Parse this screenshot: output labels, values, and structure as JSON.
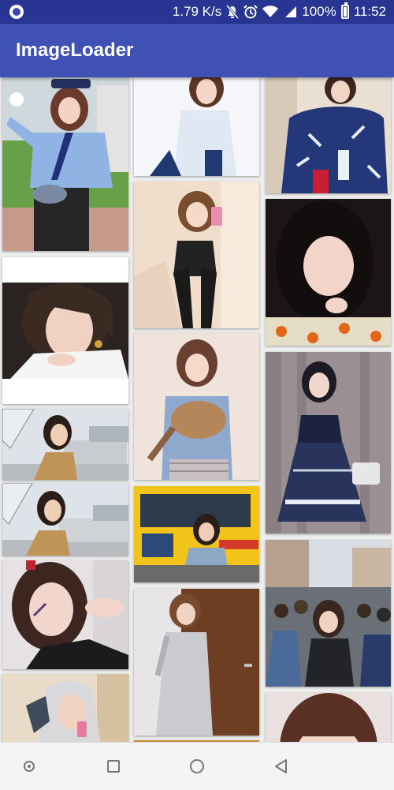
{
  "status_bar": {
    "speed": "1.79 K/s",
    "battery_percent": "100%",
    "time": "11:52",
    "icons": [
      "notification-app-icon",
      "mute-icon",
      "alarm-icon",
      "wifi-icon",
      "signal-icon",
      "battery-charging-icon"
    ]
  },
  "app_bar": {
    "title": "ImageLoader"
  },
  "colors": {
    "status_bar": "#283593",
    "app_bar": "#3f51b5",
    "background": "#eeeeee"
  },
  "grid": {
    "columns": 3,
    "photos": [
      {
        "name": "photo-police-cosplay",
        "column": 1
      },
      {
        "name": "photo-white-shirt",
        "column": 2
      },
      {
        "name": "photo-blue-kimono",
        "column": 3
      },
      {
        "name": "photo-mirror-selfie",
        "column": 2
      },
      {
        "name": "photo-halloween-selfie",
        "column": 3
      },
      {
        "name": "photo-gold-earring",
        "column": 1
      },
      {
        "name": "photo-girl-with-cat",
        "column": 2
      },
      {
        "name": "photo-lolita-dress",
        "column": 3
      },
      {
        "name": "photo-umbrella-street-1",
        "column": 1
      },
      {
        "name": "photo-umbrella-street-2",
        "column": 1
      },
      {
        "name": "photo-citybus-street",
        "column": 2
      },
      {
        "name": "photo-crowd-street",
        "column": 3
      },
      {
        "name": "photo-face-paint",
        "column": 1
      },
      {
        "name": "photo-grey-coat-door",
        "column": 2
      },
      {
        "name": "photo-hooded-selfie",
        "column": 1
      },
      {
        "name": "photo-bangs-closeup",
        "column": 3
      }
    ]
  },
  "nav_bar": {
    "buttons": [
      "assist-button",
      "recents-button",
      "home-button",
      "back-button"
    ]
  }
}
